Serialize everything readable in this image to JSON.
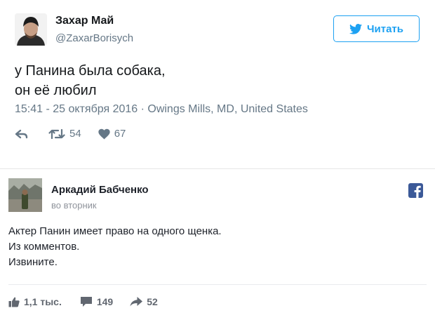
{
  "tweet": {
    "author_name": "Захар Май",
    "author_handle": "@ZaxarBorisych",
    "follow_label": "Читать",
    "text_line1": "у Панина была собака,",
    "text_line2": "он её любил",
    "meta": "15:41 - 25 октября 2016 · Owings Mills, MD, United States",
    "retweet_count": "54",
    "like_count": "67",
    "icons": [
      "reply-icon",
      "retweet-icon",
      "heart-icon",
      "twitter-bird-icon"
    ],
    "colors": {
      "brand": "#1da1f2",
      "text": "#14171a",
      "muted": "#657786"
    }
  },
  "facebook_post": {
    "author_name": "Аркадий Бабченко",
    "time": "во вторник",
    "text_line1": "Актер Панин имеет право на одного щенка.",
    "text_line2": "Из комментов.",
    "text_line3": "Извините.",
    "like_count": "1,1 тыс.",
    "comment_count": "149",
    "share_count": "52",
    "icons": [
      "facebook-logo-icon",
      "thumbs-up-icon",
      "comment-icon",
      "share-icon"
    ],
    "colors": {
      "brand": "#3b5998",
      "text": "#1d2129",
      "muted": "#90949c"
    }
  }
}
